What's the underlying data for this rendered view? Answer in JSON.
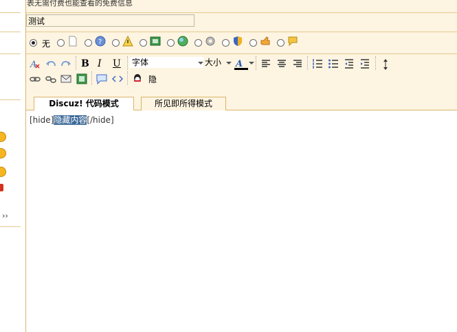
{
  "notice": {
    "text": "表无需付费也能查看的免费信息"
  },
  "subject": {
    "value": "测试"
  },
  "post_icons": {
    "none_label": "无",
    "icons": [
      "no-icon",
      "page-icon",
      "question-icon",
      "warning-icon",
      "image-icon",
      "globe-icon",
      "gear-icon",
      "shield-icon",
      "thumb-icon",
      "speech-bubble-icon"
    ]
  },
  "toolbar": {
    "font_label": "字体",
    "size_label": "大小",
    "hide_label": "隐"
  },
  "tabs": {
    "code_mode": "Discuz! 代码模式",
    "wysiwyg_mode": "所见即所得模式"
  },
  "editor": {
    "before": "[hide]",
    "selected": "隐藏内容",
    "after": "[/hide]"
  },
  "left_panel": {
    "more": "››"
  },
  "colors": {
    "panel_bg": "#fdf4e1",
    "border": "#d8b567",
    "selection": "#3d6a99"
  }
}
